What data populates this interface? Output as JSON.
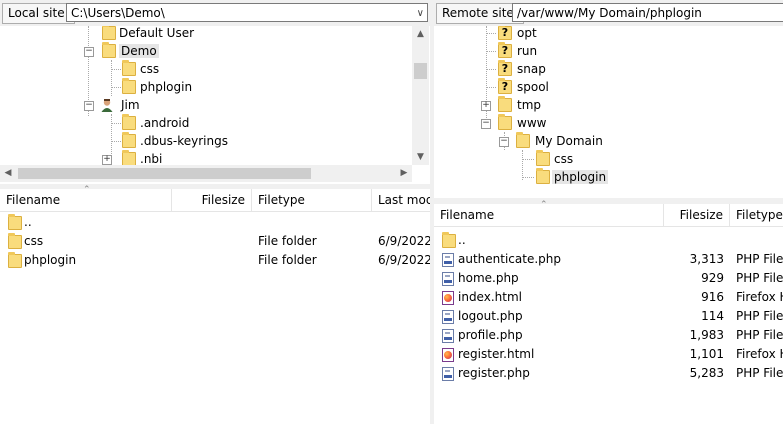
{
  "local": {
    "site_label": "Local site:",
    "path": "C:\\Users\\Demo\\",
    "tree": [
      {
        "label": "Default User",
        "type": "folder"
      },
      {
        "label": "Demo",
        "type": "folder"
      },
      {
        "label": "css",
        "type": "folder"
      },
      {
        "label": "phplogin",
        "type": "folder"
      },
      {
        "label": "Jim",
        "type": "user"
      },
      {
        "label": ".android",
        "type": "folder"
      },
      {
        "label": ".dbus-keyrings",
        "type": "folder"
      },
      {
        "label": ".nbi",
        "type": "folder"
      }
    ],
    "columns": [
      "Filename",
      "Filesize",
      "Filetype",
      "Last mod"
    ],
    "files": [
      {
        "name": "..",
        "size": "",
        "type": "",
        "modified": ""
      },
      {
        "name": "css",
        "size": "",
        "type": "File folder",
        "modified": "6/9/2022"
      },
      {
        "name": "phplogin",
        "size": "",
        "type": "File folder",
        "modified": "6/9/2022"
      }
    ]
  },
  "remote": {
    "site_label": "Remote site:",
    "path": "/var/www/My Domain/phplogin",
    "tree": [
      {
        "label": "opt",
        "type": "unknown"
      },
      {
        "label": "run",
        "type": "unknown"
      },
      {
        "label": "snap",
        "type": "unknown"
      },
      {
        "label": "spool",
        "type": "unknown"
      },
      {
        "label": "tmp",
        "type": "folder"
      },
      {
        "label": "www",
        "type": "folder"
      },
      {
        "label": "My Domain",
        "type": "folder"
      },
      {
        "label": "css",
        "type": "folder"
      },
      {
        "label": "phplogin",
        "type": "folder"
      }
    ],
    "columns": [
      "Filename",
      "Filesize",
      "Filetype"
    ],
    "files": [
      {
        "name": "..",
        "size": "",
        "type": "",
        "icon": "folder-icon"
      },
      {
        "name": "authenticate.php",
        "size": "3,313",
        "type": "PHP File",
        "icon": "php-file-icon"
      },
      {
        "name": "home.php",
        "size": "929",
        "type": "PHP File",
        "icon": "php-file-icon"
      },
      {
        "name": "index.html",
        "size": "916",
        "type": "Firefox H",
        "icon": "firefox-html-icon"
      },
      {
        "name": "logout.php",
        "size": "114",
        "type": "PHP File",
        "icon": "php-file-icon"
      },
      {
        "name": "profile.php",
        "size": "1,983",
        "type": "PHP File",
        "icon": "php-file-icon"
      },
      {
        "name": "register.html",
        "size": "1,101",
        "type": "Firefox H",
        "icon": "firefox-html-icon"
      },
      {
        "name": "register.php",
        "size": "5,283",
        "type": "PHP File",
        "icon": "php-file-icon"
      }
    ]
  },
  "colors": {
    "folder": "#f9dc7d",
    "selection": "#e5e5e5",
    "chrome": "#f0f0f0"
  }
}
